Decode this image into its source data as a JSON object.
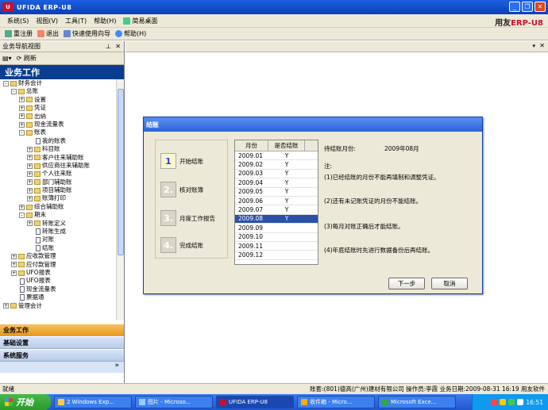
{
  "window": {
    "title": "UFIDA ERP-U8"
  },
  "menu": [
    {
      "label": "系统(S)"
    },
    {
      "label": "视图(V)"
    },
    {
      "label": "工具(T)"
    },
    {
      "label": "帮助(H)"
    },
    {
      "label": "简易桌面"
    }
  ],
  "brand": {
    "left": "用友",
    "right": "ERP-U8"
  },
  "toolbar": [
    {
      "label": "重注册"
    },
    {
      "label": "退出"
    },
    {
      "label": "快速使用向导"
    },
    {
      "label": "帮助(H)"
    }
  ],
  "nav": {
    "header": "业务导航视图",
    "refresh": "刷新",
    "banner": "业务工作",
    "tree": [
      {
        "label": "财务会计",
        "indent": 0,
        "type": "folder",
        "exp": "-"
      },
      {
        "label": "总账",
        "indent": 1,
        "type": "folder",
        "exp": "-"
      },
      {
        "label": "设置",
        "indent": 2,
        "type": "folder",
        "exp": "+"
      },
      {
        "label": "凭证",
        "indent": 2,
        "type": "folder",
        "exp": "+"
      },
      {
        "label": "出纳",
        "indent": 2,
        "type": "folder",
        "exp": "+"
      },
      {
        "label": "现金流量表",
        "indent": 2,
        "type": "folder",
        "exp": "+"
      },
      {
        "label": "账表",
        "indent": 2,
        "type": "folder",
        "exp": "-"
      },
      {
        "label": "我的账表",
        "indent": 3,
        "type": "leaf",
        "exp": ""
      },
      {
        "label": "科目账",
        "indent": 3,
        "type": "folder",
        "exp": "+"
      },
      {
        "label": "客户往来辅助账",
        "indent": 3,
        "type": "folder",
        "exp": "+"
      },
      {
        "label": "供应商往来辅助账",
        "indent": 3,
        "type": "folder",
        "exp": "+"
      },
      {
        "label": "个人往来账",
        "indent": 3,
        "type": "folder",
        "exp": "+"
      },
      {
        "label": "部门辅助账",
        "indent": 3,
        "type": "folder",
        "exp": "+"
      },
      {
        "label": "项目辅助账",
        "indent": 3,
        "type": "folder",
        "exp": "+"
      },
      {
        "label": "账簿打印",
        "indent": 3,
        "type": "folder",
        "exp": "+"
      },
      {
        "label": "综合辅助账",
        "indent": 2,
        "type": "folder",
        "exp": "+"
      },
      {
        "label": "期末",
        "indent": 2,
        "type": "folder",
        "exp": "-"
      },
      {
        "label": "转账定义",
        "indent": 3,
        "type": "folder",
        "exp": "+"
      },
      {
        "label": "转账生成",
        "indent": 3,
        "type": "leaf",
        "exp": ""
      },
      {
        "label": "对账",
        "indent": 3,
        "type": "leaf",
        "exp": ""
      },
      {
        "label": "结账",
        "indent": 3,
        "type": "leaf",
        "exp": ""
      },
      {
        "label": "应收款管理",
        "indent": 1,
        "type": "folder",
        "exp": "+"
      },
      {
        "label": "应付款管理",
        "indent": 1,
        "type": "folder",
        "exp": "+"
      },
      {
        "label": "UFO报表",
        "indent": 1,
        "type": "folder",
        "exp": "+"
      },
      {
        "label": "UFO报表",
        "indent": 1,
        "type": "leaf",
        "exp": ""
      },
      {
        "label": "现金流量表",
        "indent": 1,
        "type": "leaf",
        "exp": ""
      },
      {
        "label": "票据通",
        "indent": 1,
        "type": "leaf",
        "exp": ""
      },
      {
        "label": "管理会计",
        "indent": 0,
        "type": "folder",
        "exp": "+"
      }
    ],
    "tabs": [
      {
        "label": "业务工作",
        "active": true
      },
      {
        "label": "基础设置",
        "active": false
      },
      {
        "label": "系统服务",
        "active": false
      }
    ]
  },
  "dialog": {
    "title": "结账",
    "steps": [
      {
        "num": "1",
        "label": "开始结账",
        "active": true
      },
      {
        "num": "2.",
        "label": "核对账簿",
        "active": false
      },
      {
        "num": "3.",
        "label": "月度工作报告",
        "active": false
      },
      {
        "num": "4.",
        "label": "完成结账",
        "active": false
      }
    ],
    "table": {
      "col_month": "月份",
      "col_closed": "是否结账",
      "rows": [
        {
          "month": "2009.01",
          "closed": "Y",
          "selected": false
        },
        {
          "month": "2009.02",
          "closed": "Y",
          "selected": false
        },
        {
          "month": "2009.03",
          "closed": "Y",
          "selected": false
        },
        {
          "month": "2009.04",
          "closed": "Y",
          "selected": false
        },
        {
          "month": "2009.05",
          "closed": "Y",
          "selected": false
        },
        {
          "month": "2009.06",
          "closed": "Y",
          "selected": false
        },
        {
          "month": "2009.07",
          "closed": "Y",
          "selected": false
        },
        {
          "month": "2009.08",
          "closed": "Y",
          "selected": true
        },
        {
          "month": "2009.09",
          "closed": "",
          "selected": false
        },
        {
          "month": "2009.10",
          "closed": "",
          "selected": false
        },
        {
          "month": "2009.11",
          "closed": "",
          "selected": false
        },
        {
          "month": "2009.12",
          "closed": "",
          "selected": false
        }
      ]
    },
    "info": {
      "pending_label": "待结账月份:",
      "pending_value": "2009年08月",
      "note_title": "注:",
      "notes": [
        "(1)已经结账的月份不能再填制和调整凭证。",
        "(2)还有未记账凭证的月份不能结账。",
        "(3)每月对账正确后才能结账。",
        "(4)年底结账时先进行数据备份后再结账。"
      ]
    },
    "next_button": "下一步",
    "cancel_button": "取消"
  },
  "status": {
    "left": "就绪",
    "right": "账套:(801)德高(广州)建材有限公司 操作员:李霞 业务日期:2009-08-31 16:19 用友软件"
  },
  "taskbar": {
    "start": "开始",
    "tasks": [
      {
        "label": "2 Windows Exp..."
      },
      {
        "label": "图片 - Microso..."
      },
      {
        "label": "UFIDA ERP-U8",
        "active": true
      },
      {
        "label": "收件箱 - Micro..."
      },
      {
        "label": "Microsoft Exce..."
      }
    ],
    "clock": "16:51"
  }
}
